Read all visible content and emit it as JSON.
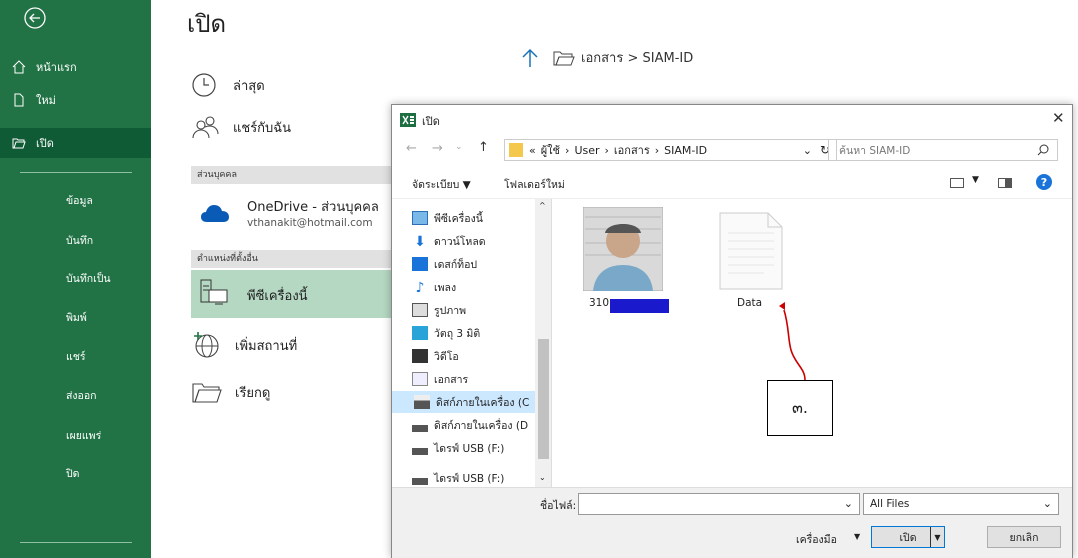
{
  "sidebar": {
    "items": [
      {
        "label": "หน้าแรก",
        "icon": "home-icon"
      },
      {
        "label": "ใหม่",
        "icon": "new-document-icon"
      },
      {
        "label": "เปิด",
        "icon": "open-folder-icon"
      }
    ],
    "sub_items": [
      "ข้อมูล",
      "บันทึก",
      "บันทึกเป็น",
      "พิมพ์",
      "แชร์",
      "ส่งออก",
      "เผยแพร่",
      "ปิด"
    ]
  },
  "main": {
    "title": "เปิด",
    "recent_label": "ล่าสุด",
    "shared_label": "แชร์กับฉัน",
    "personal_group": "ส่วนบุคคล",
    "onedrive_title": "OneDrive - ส่วนบุคคล",
    "onedrive_email": "vthanakit@hotmail.com",
    "other_locations_group": "ตำแหน่งที่ตั้งอื่น",
    "this_pc_label": "พีซีเครื่องนี้",
    "add_place_label": "เพิ่มสถานที่",
    "browse_label": "เรียกดู",
    "path": "เอกสาร > SIAM-ID"
  },
  "dialog": {
    "title": "เปิด",
    "address": [
      "«",
      "ผู้ใช้",
      "›",
      "User",
      "›",
      "เอกสาร",
      "›",
      "SIAM-ID"
    ],
    "search_placeholder": "ค้นหา SIAM-ID",
    "organize_label": "จัดระเบียบ ▼",
    "new_folder_label": "โฟลเดอร์ใหม่",
    "nav_items": [
      {
        "label": "พีซีเครื่องนี้",
        "icon": "computer-icon"
      },
      {
        "label": "ดาวน์โหลด",
        "icon": "download-icon"
      },
      {
        "label": "เดสก์ท็อป",
        "icon": "desktop-icon"
      },
      {
        "label": "เพลง",
        "icon": "music-icon"
      },
      {
        "label": "รูปภาพ",
        "icon": "pictures-icon"
      },
      {
        "label": "วัตถุ 3 มิติ",
        "icon": "3d-objects-icon"
      },
      {
        "label": "วิดีโอ",
        "icon": "video-icon"
      },
      {
        "label": "เอกสาร",
        "icon": "documents-icon"
      },
      {
        "label": "ดิสก์ภายในเครื่อง (C",
        "icon": "drive-icon"
      },
      {
        "label": "ดิสก์ภายในเครื่อง (D",
        "icon": "drive-icon"
      },
      {
        "label": "ไดรฟ์ USB (F:)",
        "icon": "usb-drive-icon"
      },
      {
        "label": "ไดรฟ์ USB (F:)",
        "icon": "usb-drive-icon"
      }
    ],
    "files": [
      {
        "name": "310",
        "type": "photo"
      },
      {
        "name": "Data",
        "type": "document"
      }
    ],
    "filename_label": "ชื่อไฟล์:",
    "filename_value": "",
    "filter_value": "All Files",
    "tools_label": "เครื่องมือ",
    "open_label": "เปิด",
    "cancel_label": "ยกเลิก"
  },
  "annotation": {
    "label": "๓."
  },
  "colors": {
    "excel_green": "#217346",
    "selection": "#cce8ff",
    "annotation_arrow": "#cc0000",
    "redaction": "#1a1acc"
  }
}
